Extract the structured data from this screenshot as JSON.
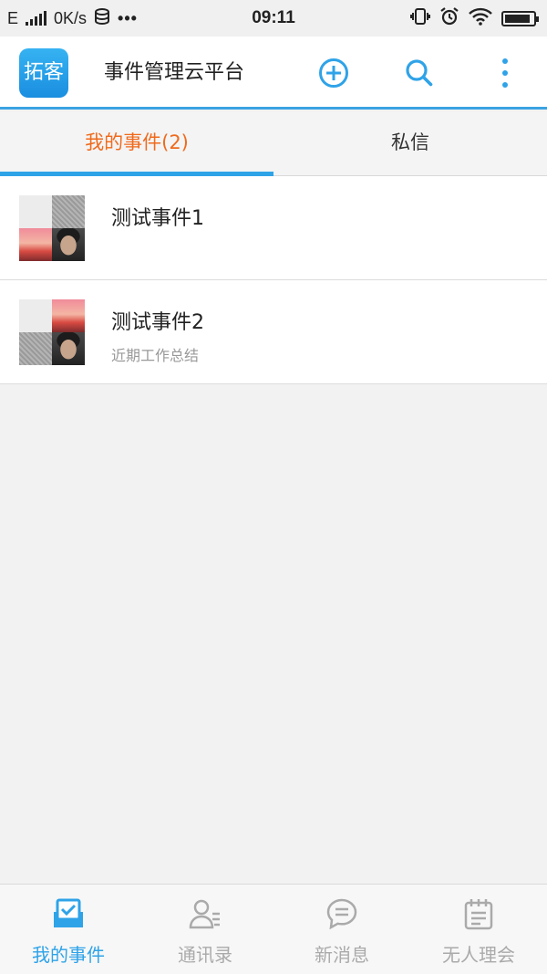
{
  "status_bar": {
    "network": "E",
    "speed": "0K/s",
    "time": "09:11",
    "battery_level": 0.9
  },
  "app_bar": {
    "logo_text": "拓客",
    "title": "事件管理云平台",
    "add_icon": "plus-circle-icon",
    "search_icon": "search-icon",
    "more_icon": "more-vertical-icon"
  },
  "tabs": [
    {
      "label": "我的事件(2)",
      "active": true
    },
    {
      "label": "私信",
      "active": false
    }
  ],
  "events": [
    {
      "title": "测试事件1",
      "subtitle": ""
    },
    {
      "title": "测试事件2",
      "subtitle": "近期工作总结"
    }
  ],
  "bottom_nav": [
    {
      "label": "我的事件",
      "icon": "inbox-check-icon",
      "active": true
    },
    {
      "label": "通讯录",
      "icon": "contacts-icon",
      "active": false
    },
    {
      "label": "新消息",
      "icon": "message-bubble-icon",
      "active": false
    },
    {
      "label": "无人理会",
      "icon": "calendar-note-icon",
      "active": false
    }
  ],
  "colors": {
    "accent": "#2fa3e8",
    "active_tab": "#f06a1c",
    "inactive_nav": "#aaaaaa"
  }
}
